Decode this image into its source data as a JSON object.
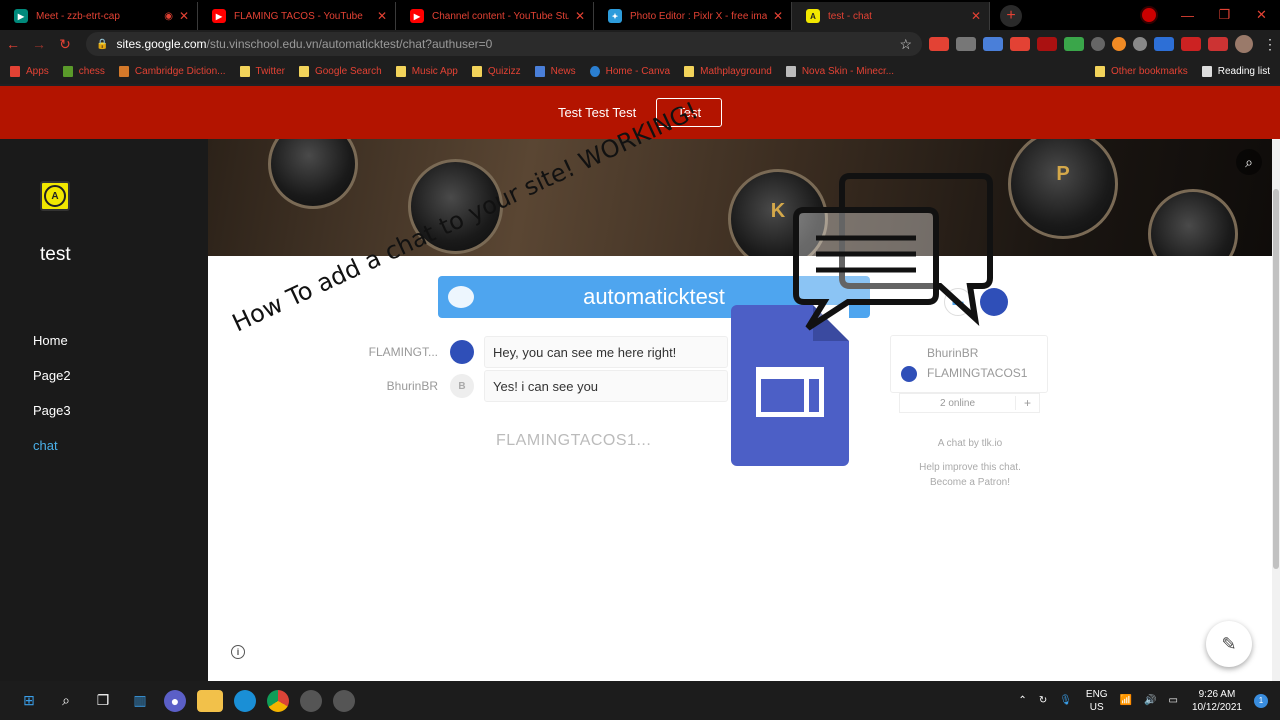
{
  "browser": {
    "tabs": [
      {
        "title": "Meet - zzb-etrt-cap",
        "icon": "meet-icon",
        "color": "#00897b"
      },
      {
        "title": "FLAMING TACOS - YouTube",
        "icon": "youtube-icon",
        "color": "#ff0000"
      },
      {
        "title": "Channel content - YouTube Studio",
        "icon": "youtube-icon",
        "color": "#ff0000"
      },
      {
        "title": "Photo Editor : Pixlr X - free image editing",
        "icon": "pixlr-icon",
        "color": "#2d9cdb"
      },
      {
        "title": "test - chat",
        "icon": "sites-icon",
        "color": "#f2e800"
      }
    ],
    "url_host": "sites.google.com",
    "url_path": "/stu.vinschool.edu.vn/automaticktest/chat?authuser=0",
    "bookmarks": [
      "Apps",
      "chess",
      "Cambridge Diction...",
      "Twitter",
      "Google Search",
      "Music App",
      "Quizizz",
      "News",
      "Home - Canva",
      "Mathplayground",
      "Nova Skin - Minecr..."
    ],
    "bookmarks_right": [
      "Other bookmarks",
      "Reading list"
    ],
    "accent": "#e34234"
  },
  "site": {
    "header_title": "Test Test Test",
    "header_button": "Test",
    "site_name": "test",
    "logo_letter": "A",
    "nav": [
      "Home",
      "Page2",
      "Page3",
      "chat"
    ],
    "active_nav": "chat",
    "banner_keys": [
      "K",
      "P"
    ],
    "banner_color": "#b31400"
  },
  "chat": {
    "room_title": "automaticktest",
    "messages": [
      {
        "author": "FLAMINGT...",
        "avatar": "",
        "text": "Hey, you can see me here right!"
      },
      {
        "author": "BhurinBR",
        "avatar": "B",
        "text": "Yes! i can see you"
      }
    ],
    "typing_indicator": "FLAMINGTACOS1...",
    "users": [
      "BhurinBR",
      "FLAMINGTACOS1"
    ],
    "online_count": "2 online",
    "add_label": "+",
    "credit_line": "A chat by tlk.io",
    "patron_line_1": "Help improve this chat.",
    "patron_line_2": "Become a Patron!"
  },
  "overlay": {
    "headline": "How To add a chat to your site! WORKING!"
  },
  "taskbar": {
    "lang_1": "ENG",
    "lang_2": "US",
    "time": "9:26 AM",
    "date": "10/12/2021",
    "notifications": "1"
  }
}
